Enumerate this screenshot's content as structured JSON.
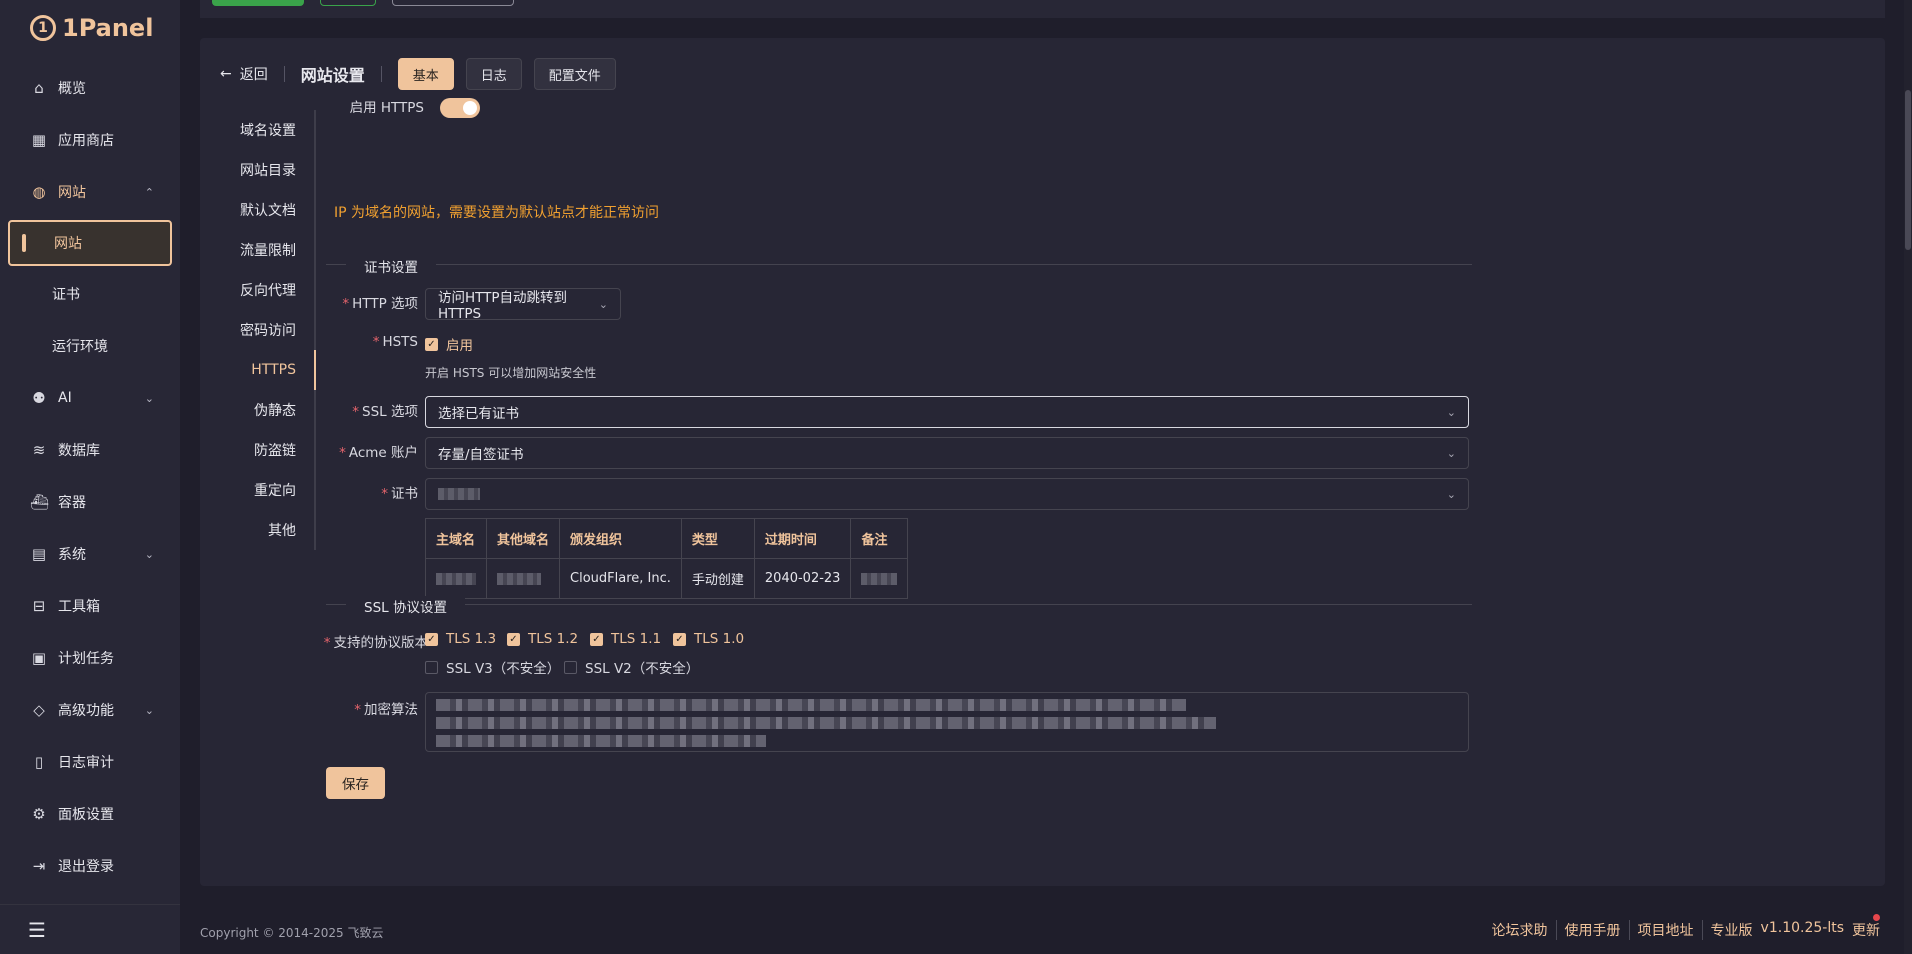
{
  "app": {
    "logo_text": "1Panel"
  },
  "sidebar": {
    "items": [
      {
        "label": "概览",
        "icon": "home-icon"
      },
      {
        "label": "应用商店",
        "icon": "apps-icon"
      },
      {
        "label": "网站",
        "icon": "globe-icon",
        "open": true
      },
      {
        "label": "AI",
        "icon": "robot-icon"
      },
      {
        "label": "数据库",
        "icon": "database-icon"
      },
      {
        "label": "容器",
        "icon": "container-icon"
      },
      {
        "label": "系统",
        "icon": "server-icon"
      },
      {
        "label": "工具箱",
        "icon": "toolbox-icon"
      },
      {
        "label": "计划任务",
        "icon": "calendar-icon"
      },
      {
        "label": "高级功能",
        "icon": "diamond-icon"
      },
      {
        "label": "日志审计",
        "icon": "log-icon"
      },
      {
        "label": "面板设置",
        "icon": "gear-icon"
      },
      {
        "label": "退出登录",
        "icon": "logout-icon"
      }
    ],
    "website_sub": [
      "网站",
      "证书",
      "运行环境"
    ]
  },
  "header": {
    "back_label": "返回",
    "title": "网站设置",
    "tabs": [
      "基本",
      "日志",
      "配置文件"
    ]
  },
  "subnav": [
    "域名设置",
    "网站目录",
    "默认文档",
    "流量限制",
    "反向代理",
    "密码访问",
    "HTTPS",
    "伪静态",
    "防盗链",
    "重定向",
    "其他"
  ],
  "https": {
    "enable_label": "启用 HTTPS",
    "warning": "IP 为域名的网站，需要设置为默认站点才能正常访问",
    "cert_section": "证书设置",
    "http_option_label": "HTTP 选项",
    "http_option_value": "访问HTTP自动跳转到HTTPS",
    "hsts_label": "HSTS",
    "hsts_check_label": "启用",
    "hsts_hint": "开启 HSTS 可以增加网站安全性",
    "ssl_option_label": "SSL 选项",
    "ssl_option_value": "选择已有证书",
    "acme_label": "Acme 账户",
    "acme_value": "存量/自签证书",
    "cert_label": "证书",
    "table_headers": [
      "主域名",
      "其他域名",
      "颁发组织",
      "类型",
      "过期时间",
      "备注"
    ],
    "table_row": {
      "issuer": "CloudFlare, Inc.",
      "type": "手动创建",
      "expiry": "2040-02-23"
    },
    "ssl_protocol_section": "SSL 协议设置",
    "protocol_label": "支持的协议版本",
    "protocols": [
      {
        "label": "TLS 1.3",
        "checked": true
      },
      {
        "label": "TLS 1.2",
        "checked": true
      },
      {
        "label": "TLS 1.1",
        "checked": true
      },
      {
        "label": "TLS 1.0",
        "checked": true
      },
      {
        "label": "SSL V3（不安全）",
        "checked": false
      },
      {
        "label": "SSL V2（不安全）",
        "checked": false
      }
    ],
    "cipher_label": "加密算法",
    "save_label": "保存"
  },
  "footer": {
    "copyright": "Copyright © 2014-2025 飞致云",
    "links": [
      "论坛求助",
      "使用手册",
      "项目地址",
      "专业版",
      "v1.10.25-lts",
      "更新"
    ]
  },
  "colors": {
    "accent": "#f0c49c",
    "warning": "#f0a030",
    "required": "#e6646c",
    "background": "#1f1e2b",
    "panel": "#272635"
  }
}
